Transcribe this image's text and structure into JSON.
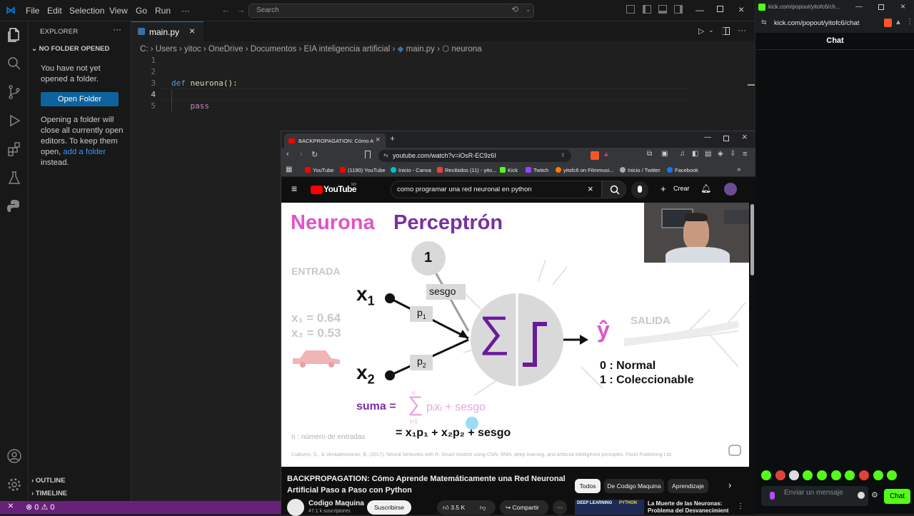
{
  "vscode": {
    "menu": [
      "File",
      "Edit",
      "Selection",
      "View",
      "Go",
      "Run",
      "···"
    ],
    "search_placeholder": "Search",
    "explorer_title": "EXPLORER",
    "section_title": "NO FOLDER OPENED",
    "msg1": "You have not yet opened a folder.",
    "open_folder_label": "Open Folder",
    "msg2_pre": "Opening a folder will close all currently open editors. To keep them open, ",
    "msg2_link": "add a folder",
    "msg2_post": " instead.",
    "outline_label": "OUTLINE",
    "timeline_label": "TIMELINE",
    "tab_label": "main.py",
    "breadcrumb": [
      "C:",
      "Users",
      "yitoc",
      "OneDrive",
      "Documentos",
      "EIA inteligencia artificial",
      "main.py",
      "neurona"
    ],
    "code_lines": [
      {
        "n": "1",
        "kw": "",
        "text": ""
      },
      {
        "n": "2",
        "kw": "",
        "text": ""
      },
      {
        "n": "3",
        "kw": "def",
        "text": " neurona():"
      },
      {
        "n": "4",
        "kw": "",
        "text": ""
      },
      {
        "n": "5",
        "kw": "",
        "text": "    pass"
      }
    ],
    "status_errors": "0",
    "status_warnings": "0"
  },
  "kick": {
    "tab_url": "kick.com/popout/yitofc6/ch...",
    "url": "kick.com/popout/yitofc6/chat",
    "chat_title": "Chat",
    "input_placeholder": "Enviar un mensaje",
    "chat_button": "Chat"
  },
  "browser": {
    "tab_title": "BACKPROPAGATION: Cómo A",
    "url": "youtube.com/watch?v=iOsR-EC9z6I",
    "bookmarks": [
      "YouTube",
      "(1190) YouTube",
      "Inicio - Canva",
      "Recibidos (11) - yito...",
      "Kick",
      "Twitch",
      "yitofc6 on Filmmusi...",
      "Inicio / Twitter",
      "Facebook"
    ],
    "yt_logo": "YouTube",
    "yt_logo_region": "MX",
    "search_query": "como programar una red neuronal en python",
    "create_label": "Crear",
    "video_title": "BACKPROPAGATION: Cómo Aprende Matemáticamente una Red Neuronal Artificial Paso a Paso con Python",
    "channel_name": "Codigo Maquina",
    "subscribers": "47.1 k suscriptores",
    "subscribe_label": "Suscribirse",
    "likes": "3.5 K",
    "share_label": "Compartir",
    "chips": [
      "Todos",
      "De Codigo Maquina",
      "Aprendizaje"
    ],
    "related_title": "La Muerte de las Neuronas: Problema del Desvanecimient",
    "related_thumb_text": "DEEP LEARNING",
    "related_thumb_text2": "PYTHON"
  },
  "slide": {
    "title_part1": "Neurona",
    "title_part2": "Perceptrón",
    "bias_value": "1",
    "bias_label": "sesgo",
    "entrada_label": "ENTRADA",
    "x1": "x",
    "x1_sub": "1",
    "x2": "x",
    "x2_sub": "2",
    "x1_value": "x₁ = 0.64",
    "x2_value": "x₂ = 0.53",
    "p1": "p",
    "p1_sub": "1",
    "p2": "p",
    "p2_sub": "2",
    "sigma": "∑",
    "salida_label": "SALIDA",
    "yhat": "ŷ",
    "out0": "0 : Normal",
    "out1": "1 : Coleccionable",
    "suma_label": "suma =",
    "sum_upper": "n",
    "sum_lower": "i=1",
    "sum_expr": "pᵢxᵢ + sesgo",
    "expanded": "= x₁p₁ + x₂p₂ + sesgo",
    "n_note": "n : número de entradas",
    "citation": "Ciaburro, G., & Venkateswaran, B. (2017). Neural Networks with R: Smart models using CNN, RNN, deep learning, and artificial intelligence principles. Packt Publishing Ltd."
  },
  "colors": {
    "pink": "#e055c8",
    "purple": "#7b2fa0",
    "accent_blue": "#0078d4",
    "status_purple": "#68217a",
    "kick_green": "#53fc18"
  }
}
